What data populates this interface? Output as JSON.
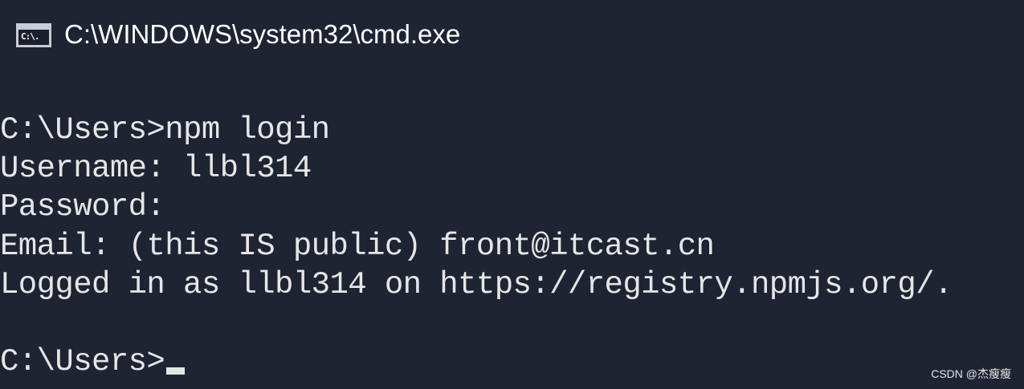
{
  "window": {
    "title": "C:\\WINDOWS\\system32\\cmd.exe",
    "icon_label": "C:\\."
  },
  "console": {
    "lines": [
      "C:\\Users>npm login",
      "Username: llbl314",
      "Password:",
      "Email: (this IS public) front@itcast.cn",
      "Logged in as llbl314 on https://registry.npmjs.org/.",
      "",
      "C:\\Users>"
    ]
  },
  "watermark": "CSDN @杰瘦瘦",
  "colors": {
    "background": "#1f2433",
    "text": "#e6e6e6"
  }
}
